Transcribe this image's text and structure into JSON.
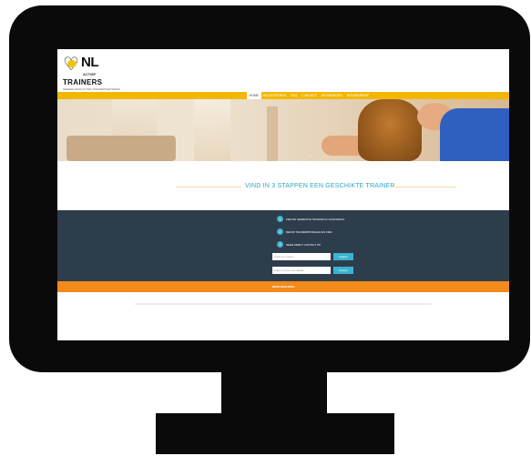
{
  "brand": {
    "logo_nl": "NL",
    "logo_actief": "ACTIEF",
    "logo_trainers": "TRAINERS",
    "tagline": "NEDERLANDS ACTIEF TRAINERSNETWERK",
    "accent": "#f2b705"
  },
  "nav": {
    "items": [
      {
        "label": "HOME",
        "active": true
      },
      {
        "label": "REGISTREREN"
      },
      {
        "label": "FAQ"
      },
      {
        "label": "CONTACT"
      },
      {
        "label": "ERVARINGEN"
      },
      {
        "label": "NIEUWSBRIEF"
      }
    ]
  },
  "hero": {
    "dots": "• • •"
  },
  "headline": "VIND IN 3 STAPPEN EEN GESCHIKTE TRAINER",
  "steps": [
    {
      "num": "1",
      "text": "KIES DE GEWENSTE TRAINING IN JOUW REGIO"
    },
    {
      "num": "2",
      "text": "BEKIJK TRAINERPROFIELEN EN KIES"
    },
    {
      "num": "3",
      "text": "NEEM DIRECT CONTACT OP"
    }
  ],
  "search": {
    "field1_placeholder": "Zoek een trainer",
    "field1_button": "Zoeken",
    "field2_placeholder": "Zoek in jouw woonplaats",
    "field2_button": "Zoeken"
  },
  "orange_bar": {
    "text": "MEER BEKIJKEN",
    "color": "#f28a1c"
  },
  "colors": {
    "steps_bg": "#2e3d4b",
    "teal": "#3bb3d0"
  }
}
